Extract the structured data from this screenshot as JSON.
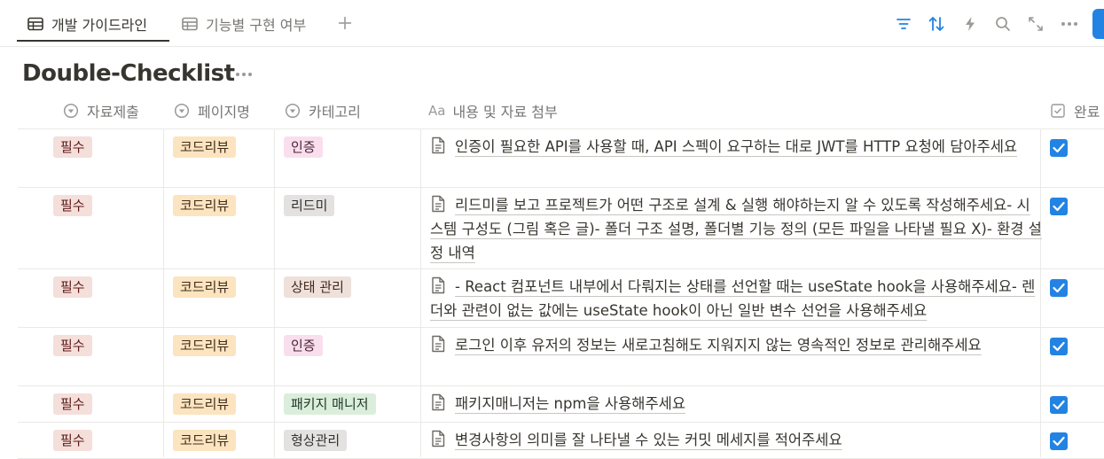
{
  "views": {
    "tabs": [
      {
        "label": "개발 가이드라인",
        "icon": "table-icon",
        "active": true
      },
      {
        "label": "기능별 구현 여부",
        "icon": "table-icon",
        "active": false
      }
    ],
    "add_label": "+"
  },
  "toolbar": {
    "icons": [
      "filter-icon",
      "sort-icon",
      "automation-icon",
      "search-icon",
      "expand-icon",
      "more-icon"
    ],
    "accent": "#2383e2"
  },
  "database": {
    "title": "Double-Checklist",
    "more_label": "···"
  },
  "columns": [
    {
      "label": "자료제출",
      "icon": "select-icon"
    },
    {
      "label": "페이지명",
      "icon": "select-icon"
    },
    {
      "label": "카테고리",
      "icon": "select-icon"
    },
    {
      "label": "내용 및 자료 첨부",
      "icon": "title-icon",
      "icon_text": "Aa"
    },
    {
      "label": "완료",
      "icon": "checkbox-icon"
    }
  ],
  "rows": [
    {
      "submit": "필수",
      "page": "코드리뷰",
      "category": "인증",
      "category_color": "#f9dfee",
      "content": "인증이 필요한 API를 사용할 때, API 스펙이 요구하는 대로 JWT를 HTTP 요청에 담아주세요",
      "done": true
    },
    {
      "submit": "필수",
      "page": "코드리뷰",
      "category": "리드미",
      "category_color": "#e3e2e0",
      "content": "리드미를 보고 프로젝트가 어떤 구조로 설계 & 실행 해야하는지 알 수 있도록 작성해주세요- 시스템 구성도 (그림 혹은 글)- 폴더 구조 설명, 폴더별 기능 정의 (모든 파일을 나타낼 필요 X)- 환경 설정 내역",
      "done": true
    },
    {
      "submit": "필수",
      "page": "코드리뷰",
      "category": "상태 관리",
      "category_color": "#eee0da",
      "content": "- React 컴포넌트 내부에서 다뤄지는 상태를 선언할 때는 useState hook을 사용해주세요- 렌더와 관련이 없는 값에는 useState hook이 아닌 일반 변수 선언을 사용해주세요",
      "done": true
    },
    {
      "submit": "필수",
      "page": "코드리뷰",
      "category": "인증",
      "category_color": "#f9dfee",
      "content": "로그인 이후 유저의 정보는 새로고침해도 지워지지 않는 영속적인 정보로 관리해주세요",
      "done": true
    },
    {
      "submit": "필수",
      "page": "코드리뷰",
      "category": "패키지 매니저",
      "category_color": "#dbeddb",
      "content": "패키지매니저는 npm을 사용해주세요",
      "done": true
    },
    {
      "submit": "필수",
      "page": "코드리뷰",
      "category": "형상관리",
      "category_color": "#e3e2e0",
      "content": "변경사항의 의미를 잘 나타낼 수 있는 커밋 메세지를 적어주세요",
      "done": true
    }
  ]
}
